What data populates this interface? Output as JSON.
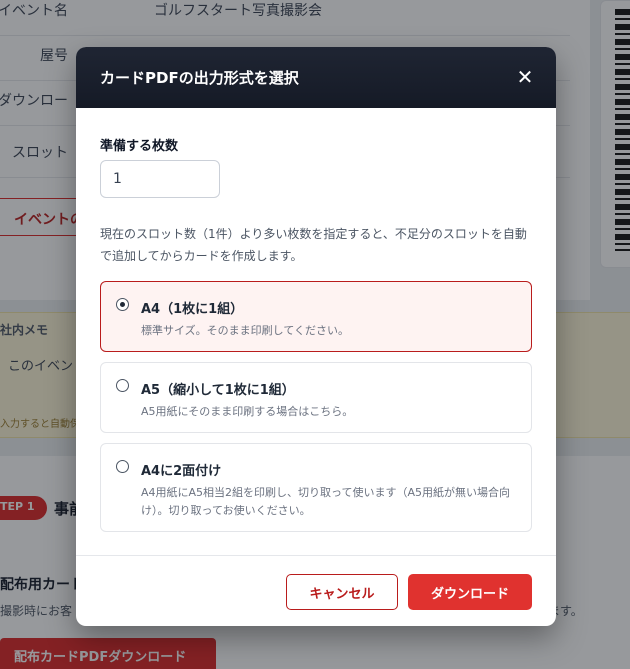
{
  "background": {
    "rows": [
      {
        "label": "イベント名",
        "value": "ゴルフスタート写真撮影会"
      },
      {
        "label": "屋号",
        "value": ""
      },
      {
        "label": "ダウンロー",
        "value": ""
      },
      {
        "label": "スロット",
        "value": ""
      }
    ],
    "tab_label": "イベントの",
    "memo_title": "社内メモ",
    "memo_body": "このイベン",
    "memo_hint": "入力すると自動保",
    "step_badge": "TEP 1",
    "step_title": "事前",
    "section_title": "配布用カート",
    "section_text": "撮影時にお客",
    "section_text_end": "ます。",
    "download_card_button": "配布カードPDFダウンロード"
  },
  "modal": {
    "title": "カードPDFの出力形式を選択",
    "close_glyph": "✕",
    "quantity_label": "準備する枚数",
    "quantity_value": "1",
    "description": "現在のスロット数（1件）より多い枚数を指定すると、不足分のスロットを自動で追加してからカードを作成します。",
    "options": [
      {
        "title": "A4（1枚に1組）",
        "desc": "標準サイズ。そのまま印刷してください。",
        "selected": true
      },
      {
        "title": "A5（縮小して1枚に1組）",
        "desc": "A5用紙にそのまま印刷する場合はこちら。",
        "selected": false
      },
      {
        "title": "A4に2面付け",
        "desc": "A4用紙にA5相当2組を印刷し、切り取って使います（A5用紙が無い場合向け）。切り取ってお使いください。",
        "selected": false
      }
    ],
    "cancel_label": "キャンセル",
    "download_label": "ダウンロード"
  },
  "colors": {
    "accent": "#e0322f",
    "header_bg": "#1a1f2c"
  }
}
